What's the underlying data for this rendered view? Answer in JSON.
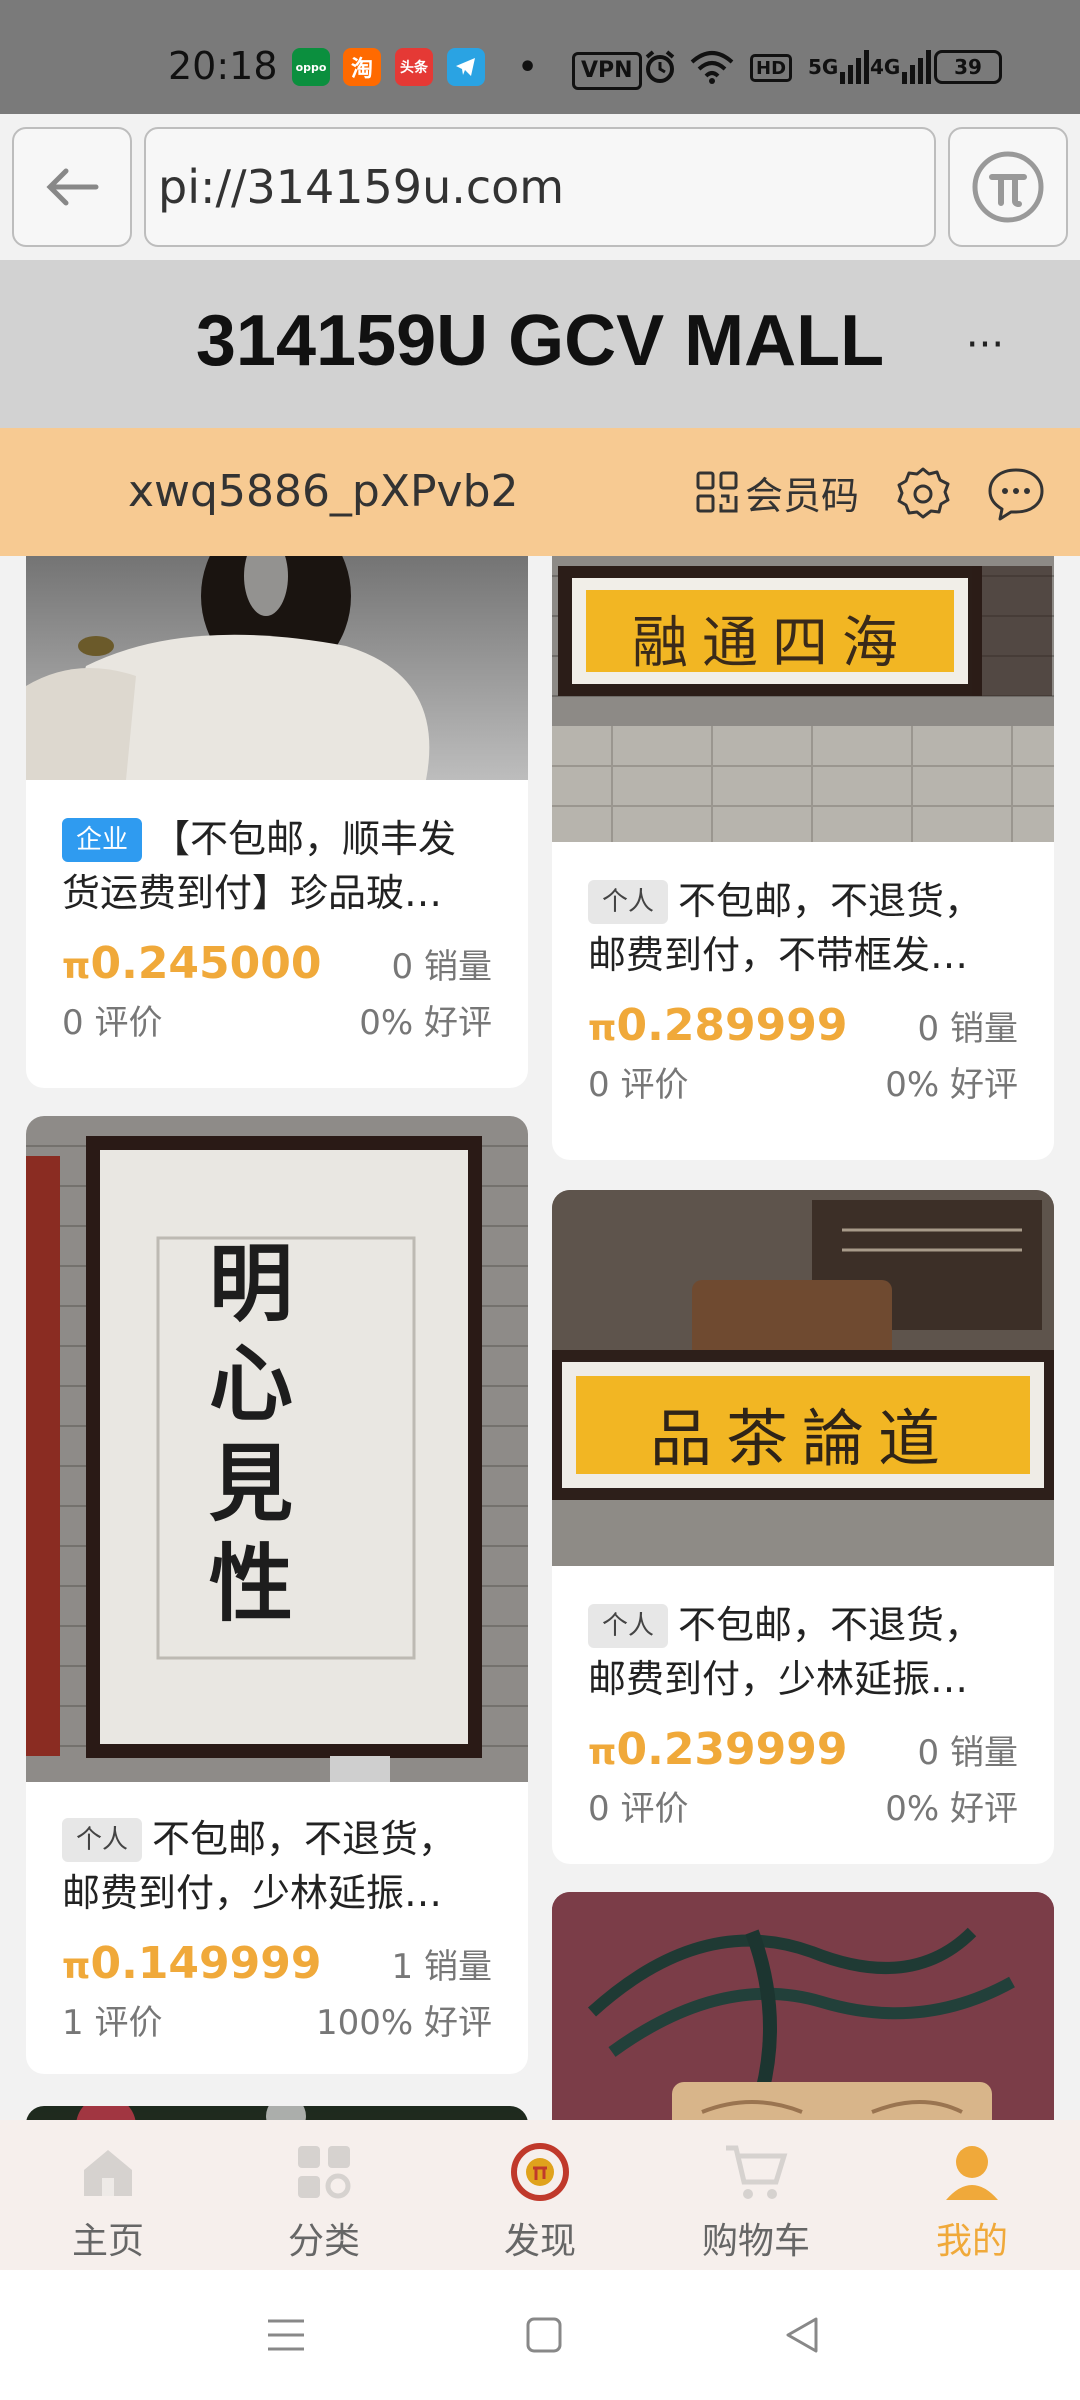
{
  "status_bar": {
    "time": "20:18",
    "apps": [
      {
        "name": "oppo",
        "label": "oppo",
        "color": "#0b8f3e"
      },
      {
        "name": "taobao",
        "label": "淘",
        "color": "#ff6a00"
      },
      {
        "name": "toutiao",
        "label": "头条",
        "color": "#e53935"
      },
      {
        "name": "telegram",
        "label": "",
        "color": "#2aa3e3"
      }
    ],
    "vpn_label": "VPN",
    "network_5g": "5G",
    "network_4g": "4G",
    "hd_label": "HD",
    "battery": "39"
  },
  "browser": {
    "url": "pi://314159u.com"
  },
  "header": {
    "title": "314159U GCV MALL",
    "more": "···"
  },
  "user": {
    "username": "xwq5886_pXPvb2",
    "member_code_label": "会员码"
  },
  "products": [
    {
      "tag": "企业",
      "title": "【不包邮，顺丰发货运费到付】珍品玻…",
      "price": "0.245000",
      "sales": "0 销量",
      "reviews": "0 评价",
      "rating": "0% 好评"
    },
    {
      "tag": "个人",
      "title": "不包邮，不退货，邮费到付，不带框发…",
      "price": "0.289999",
      "sales": "0 销量",
      "reviews": "0 评价",
      "rating": "0% 好评"
    },
    {
      "tag": "个人",
      "title": "不包邮，不退货，邮费到付，少林延振…",
      "price": "0.149999",
      "sales": "1 销量",
      "reviews": "1 评价",
      "rating": "100% 好评"
    },
    {
      "tag": "个人",
      "title": "不包邮，不退货，邮费到付，少林延振…",
      "price": "0.239999",
      "sales": "0 销量",
      "reviews": "0 评价",
      "rating": "0% 好评"
    }
  ],
  "currency_symbol": "π",
  "calligraphy": {
    "banner1": "融通四海",
    "scroll": "明心見性",
    "banner2": "品茶論道"
  },
  "bottom_nav": [
    {
      "label": "主页",
      "icon": "home-icon"
    },
    {
      "label": "分类",
      "icon": "category-icon"
    },
    {
      "label": "发现",
      "icon": "discover-logo-icon"
    },
    {
      "label": "购物车",
      "icon": "cart-icon"
    },
    {
      "label": "我的",
      "icon": "profile-icon",
      "active": true
    }
  ],
  "colors": {
    "accent": "#f0a93a",
    "user_bar": "#f7ca92",
    "header_bg": "#d2d2d2",
    "enterprise_tag": "#2f9bf0"
  }
}
